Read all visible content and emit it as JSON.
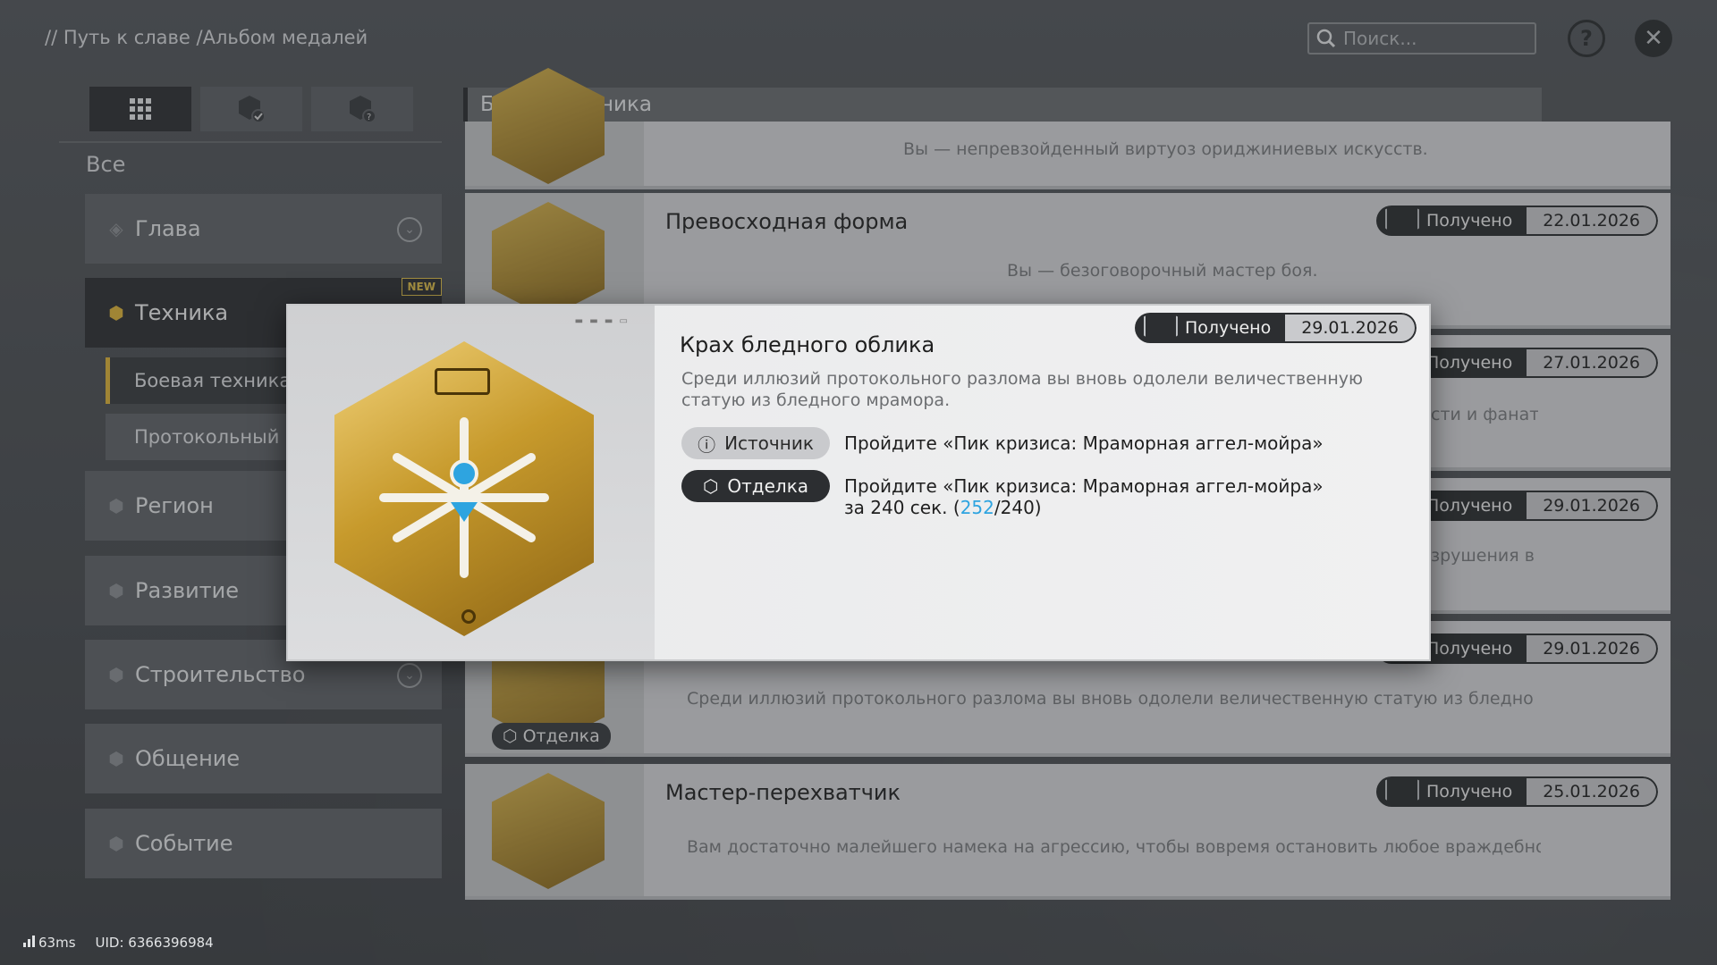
{
  "header": {
    "breadcrumb": "// Путь к славе /Альбом медалей",
    "search_placeholder": "Поиск..."
  },
  "sidebar": {
    "all_label": "Все",
    "items": [
      {
        "label": "Глава"
      },
      {
        "label": "Техника",
        "badge": "NEW"
      },
      {
        "label": "Регион"
      },
      {
        "label": "Развитие"
      },
      {
        "label": "Строительство"
      },
      {
        "label": "Общение"
      },
      {
        "label": "Событие"
      }
    ],
    "sub_items": [
      {
        "label": "Боевая техника"
      },
      {
        "label": "Протокольный р"
      }
    ]
  },
  "list": {
    "header": "Боевая техника",
    "cards": [
      {
        "title": "",
        "desc": "Вы — непревзойденный виртуоз ориджиниевых искусств.",
        "status": "",
        "date": ""
      },
      {
        "title": "Превосходная форма",
        "desc": "Вы — безоговорочный мастер боя.",
        "status": "Получено",
        "date": "22.01.2026"
      },
      {
        "title": "",
        "desc": "сти и фанат",
        "status": "Получено",
        "date": "27.01.2026"
      },
      {
        "title": "",
        "desc": "зрушения в",
        "status": "Получено",
        "date": "29.01.2026"
      },
      {
        "title": "",
        "desc": "Среди иллюзий протокольного разлома вы вновь одолели величественную статую из бледно",
        "status": "Получено",
        "date": "29.01.2026",
        "tag": "Отделка"
      },
      {
        "title": "Мастер-перехватчик",
        "desc": "Вам достаточно малейшего намека на агрессию, чтобы вовремя остановить любое враждебно",
        "status": "Получено",
        "date": "25.01.2026"
      }
    ]
  },
  "modal": {
    "title": "Крах бледного облика",
    "status": "Получено",
    "date": "29.01.2026",
    "description": "Среди иллюзий протокольного разлома вы вновь одолели величественную статую из бледного мрамора.",
    "source_label": "Источник",
    "source_text": "Пройдите «Пик кризиса: Мраморная аггел-мойра»",
    "finish_label": "Отделка",
    "finish_text_pre": "Пройдите «Пик кризиса: Мраморная аггел-мойра» за 240 сек. (",
    "finish_progress": "252",
    "finish_text_post": "/240)"
  },
  "footer": {
    "ping": "63ms",
    "uid": "UID: 6366396984"
  },
  "colors": {
    "accent_gold": "#e0b53a",
    "highlight_blue": "#2ea4e0",
    "dark": "#2c2e31"
  }
}
